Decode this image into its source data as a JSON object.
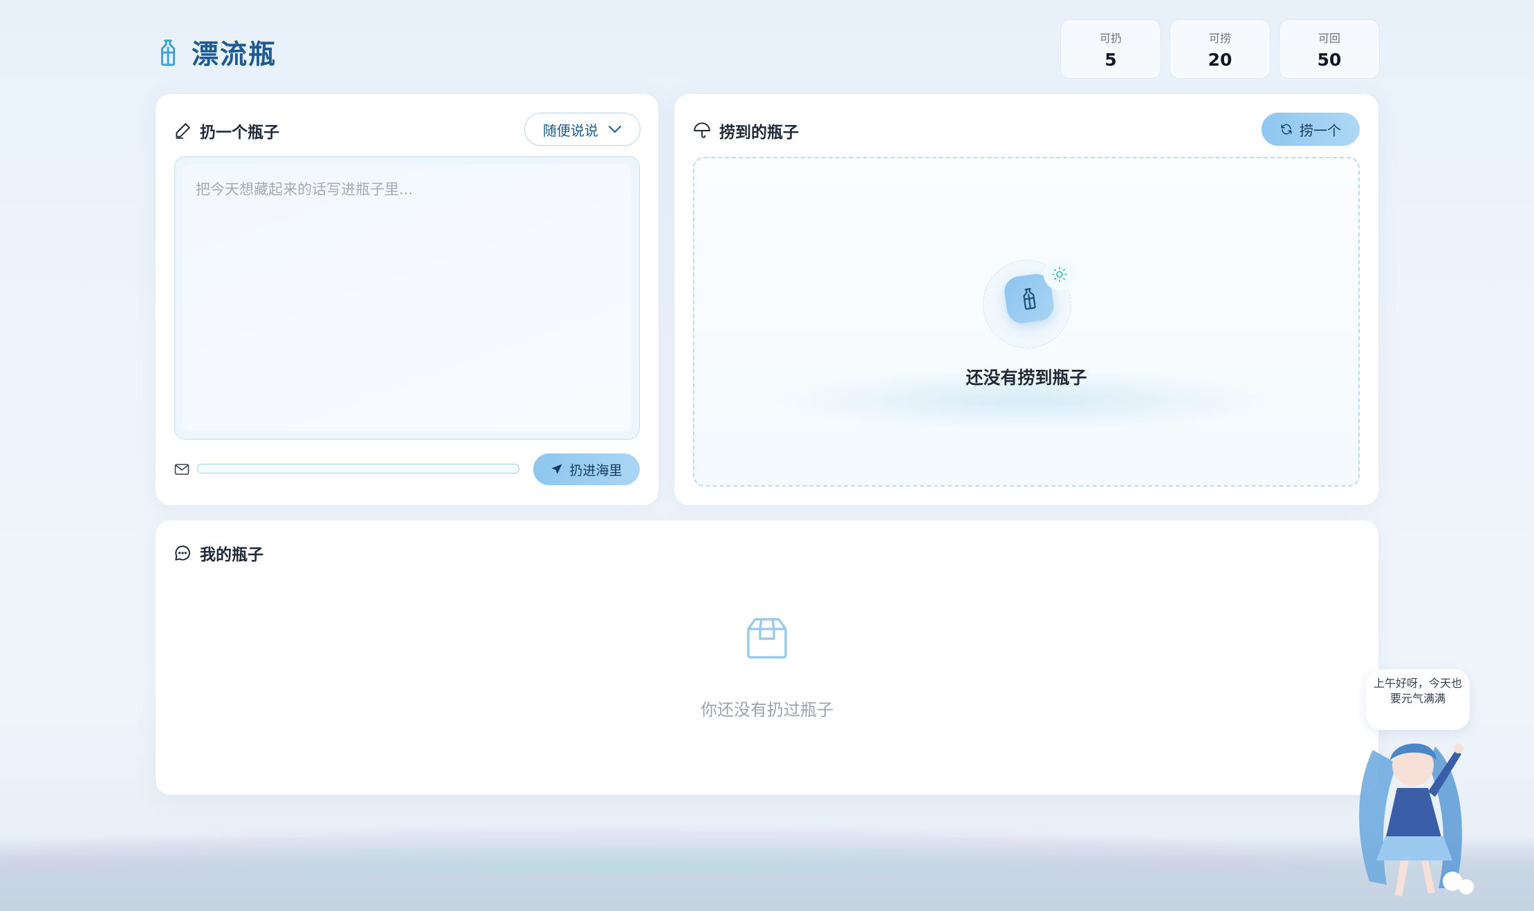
{
  "app": {
    "title": "漂流瓶"
  },
  "stats": [
    {
      "label": "可扔",
      "value": "5"
    },
    {
      "label": "可捞",
      "value": "20"
    },
    {
      "label": "可回",
      "value": "50"
    }
  ],
  "throw_card": {
    "title": "扔一个瓶子",
    "mood_selected": "随便说说",
    "placeholder": "把今天想藏起来的话写进瓶子里...",
    "button": "扔进海里",
    "progress_fraction": 0
  },
  "fish_card": {
    "title": "捞到的瓶子",
    "button": "捞一个",
    "empty_text": "还没有捞到瓶子"
  },
  "mine_card": {
    "title": "我的瓶子",
    "empty_text": "你还没有扔过瓶子"
  },
  "mascot": {
    "bubble": "上午好呀，今天也要元气满满"
  },
  "colors": {
    "accent": "#8ec6ef",
    "brand": "#1d5a92",
    "outline": "#b7d3ec"
  }
}
